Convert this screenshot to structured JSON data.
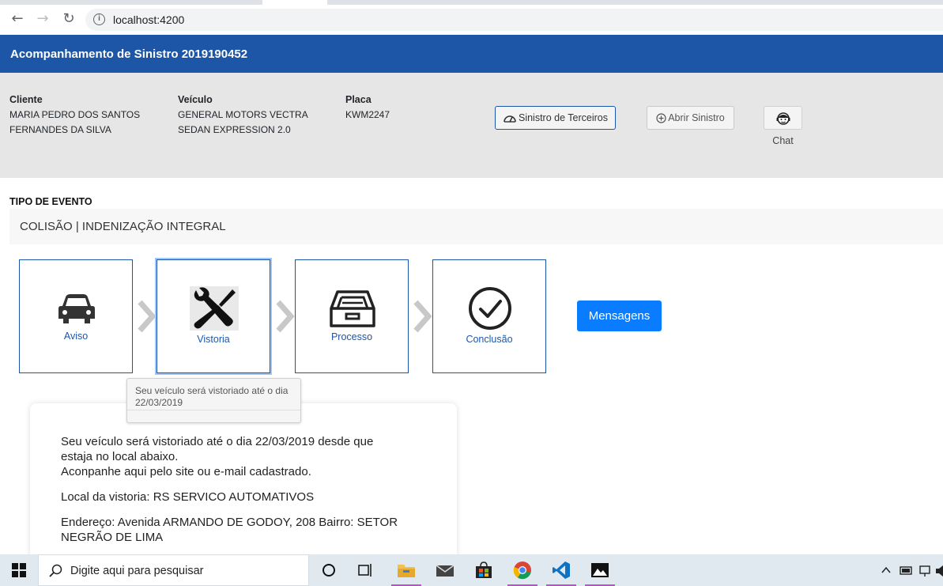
{
  "browser": {
    "url": "localhost:4200",
    "back_icon": "←",
    "forward_icon": "→",
    "reload_icon": "↻",
    "info_icon": "i"
  },
  "header": {
    "title": "Acompanhamento de Sinistro 2019190452",
    "color": "#1d56a7"
  },
  "info": {
    "cliente_label": "Cliente",
    "cliente_line1": "MARIA PEDRO DOS SANTOS",
    "cliente_line2": "FERNANDES DA SILVA",
    "veiculo_label": "Veículo",
    "veiculo_line1": "GENERAL MOTORS VECTRA",
    "veiculo_line2": "SEDAN EXPRESSION 2.0",
    "placa_label": "Placa",
    "placa_value": "KWM2247",
    "btn_terceiros": "Sinistro de Terceiros",
    "btn_abrir": "Abrir Sinistro",
    "chat_label": "Chat"
  },
  "tipo": {
    "label": "TIPO DE EVENTO",
    "value": "COLISÃO | INDENIZAÇÃO INTEGRAL"
  },
  "steps": [
    {
      "label": "Aviso",
      "icon": "car-icon"
    },
    {
      "label": "Vistoria",
      "icon": "tools-icon"
    },
    {
      "label": "Processo",
      "icon": "inbox-tray-icon"
    },
    {
      "label": "Conclusão",
      "icon": "check-circle-icon"
    }
  ],
  "mensagens_button": "Mensagens",
  "tooltip": {
    "text": "Seu veículo será vistoriado até o dia 22/03/2019"
  },
  "card": {
    "p1_line1": "Seu veículo será vistoriado até o dia 22/03/2019 desde que",
    "p1_line2": "estaja no local abaixo.",
    "p1_line3": "Aconpanhe aqui pelo site ou e-mail cadastrado.",
    "local": "Local da vistoria: RS SERVICO AUTOMATIVOS",
    "endereco_line1": "Endereço: Avenida ARMANDO DE GODOY, 208 Bairro: SETOR",
    "endereco_line2": "NEGRÃO DE LIMA"
  },
  "taskbar": {
    "search_placeholder": "Digite aqui para pesquisar",
    "accent_color": "#c24bd1"
  }
}
